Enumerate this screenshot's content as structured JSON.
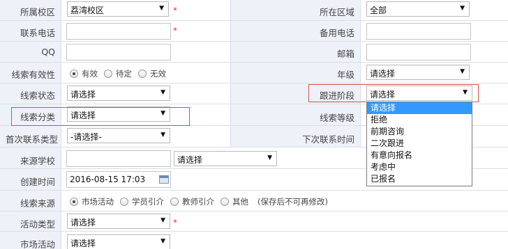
{
  "form": {
    "campus": {
      "label": "所属校区",
      "value": "荔湾校区",
      "required": "*"
    },
    "region": {
      "label": "所在区域",
      "value": "全部"
    },
    "phone": {
      "label": "联系电话",
      "value": "",
      "required": "*"
    },
    "backup_phone": {
      "label": "备用电话",
      "value": ""
    },
    "qq": {
      "label": "QQ",
      "value": ""
    },
    "email": {
      "label": "邮箱",
      "value": ""
    },
    "validity": {
      "label": "线索有效性",
      "options": [
        "有效",
        "待定",
        "无效"
      ],
      "selected": "有效"
    },
    "grade": {
      "label": "年级",
      "value": "请选择"
    },
    "status": {
      "label": "线索状态",
      "value": "请选择"
    },
    "stage": {
      "label": "跟进阶段",
      "value": "请选择"
    },
    "category": {
      "label": "线索分类",
      "value": "请选择"
    },
    "level": {
      "label": "线索等级"
    },
    "first_contact_type": {
      "label": "首次联系类型",
      "value": "-请选择-"
    },
    "next_contact_time": {
      "label": "下次联系时间"
    },
    "source_school": {
      "label": "来源学校",
      "value": "",
      "select_value": "请选择"
    },
    "created_time": {
      "label": "创建时间",
      "value": "2016-08-15 17:03"
    },
    "source": {
      "label": "线索来源",
      "options": [
        "市场活动",
        "学员引介",
        "教师引介",
        "其他"
      ],
      "selected": "市场活动",
      "note": "(保存后不可再修改)"
    },
    "activity_type": {
      "label": "活动类型",
      "value": "请选择",
      "required": "*"
    },
    "market_activity": {
      "label": "市场活动",
      "value": "请选择"
    }
  },
  "stage_dropdown": {
    "items": [
      "请选择",
      "拒绝",
      "前期咨询",
      "二次跟进",
      "有意向报名",
      "考虑中",
      "已报名"
    ],
    "highlighted": "请选择"
  },
  "icons": {
    "select_arrow": "▼",
    "calendar": "calendar-icon"
  },
  "colors": {
    "label_bg": "#eef1f8",
    "highlight_border": "#d94d4d",
    "dropdown_active": "#3399ff",
    "required": "#e03131"
  }
}
